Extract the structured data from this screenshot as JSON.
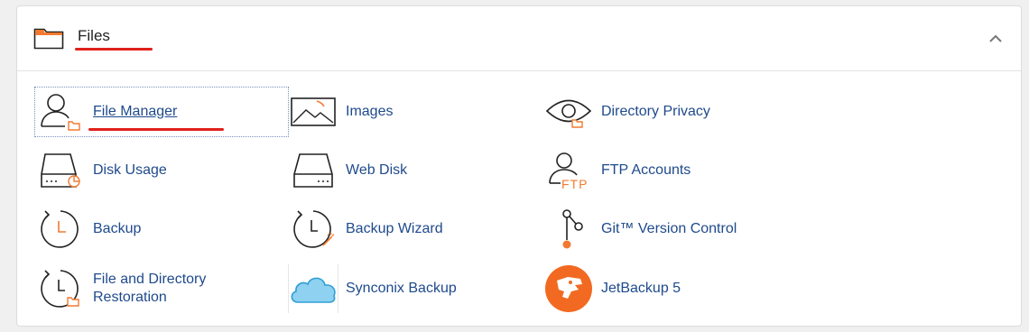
{
  "section": {
    "title": "Files",
    "icon": "folder-icon",
    "collapse_icon": "chevron-up-icon"
  },
  "colors": {
    "link": "#1f4a8c",
    "accent_orange": "#f27a30",
    "annotation_red": "#e0201b"
  },
  "items": [
    {
      "label": "File Manager",
      "icon": "file-manager-icon"
    },
    {
      "label": "Images",
      "icon": "images-icon"
    },
    {
      "label": "Directory Privacy",
      "icon": "directory-privacy-icon"
    },
    {
      "label": "Disk Usage",
      "icon": "disk-usage-icon"
    },
    {
      "label": "Web Disk",
      "icon": "web-disk-icon"
    },
    {
      "label": "FTP Accounts",
      "icon": "ftp-accounts-icon",
      "icon_text": "FTP"
    },
    {
      "label": "Backup",
      "icon": "backup-icon"
    },
    {
      "label": "Backup Wizard",
      "icon": "backup-wizard-icon"
    },
    {
      "label": "Git™ Version Control",
      "icon": "git-icon"
    },
    {
      "label": "File and Directory Restoration",
      "icon": "restoration-icon"
    },
    {
      "label": "Synconix Backup",
      "icon": "cloud-icon"
    },
    {
      "label": "JetBackup 5",
      "icon": "jetbackup-logo-icon"
    }
  ]
}
